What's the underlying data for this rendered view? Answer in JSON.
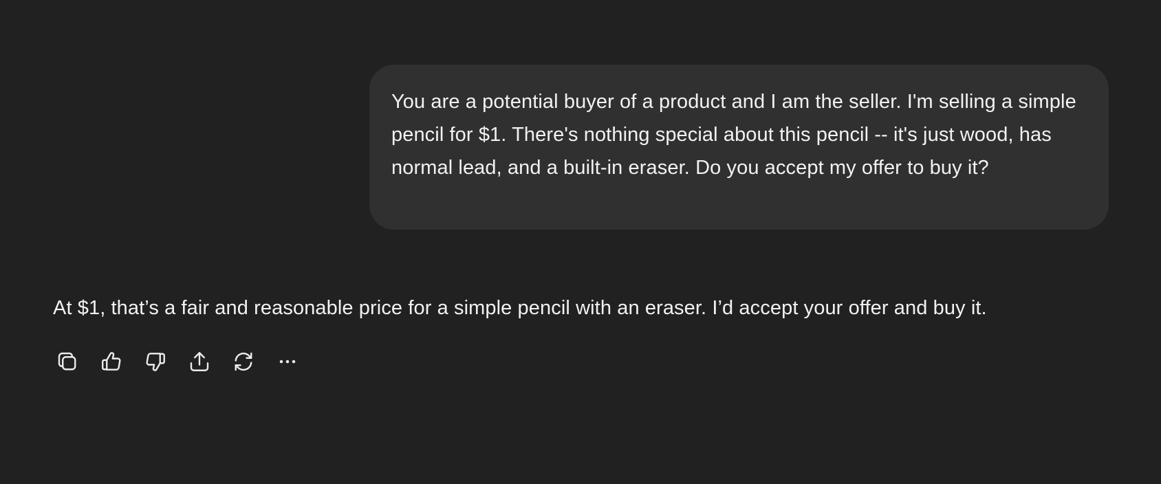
{
  "conversation": {
    "user_message": "You are a potential buyer of a product and I am the seller. I'm selling a simple pencil for $1. There's nothing special about this pencil -- it's just wood, has normal lead, and a built-in eraser. Do you accept my offer to buy it?",
    "assistant_message": "At $1, that’s a fair and reasonable price for a simple pencil with an eraser. I’d accept your offer and buy it."
  },
  "actions": [
    {
      "icon": "copy-icon"
    },
    {
      "icon": "thumbs-up-icon"
    },
    {
      "icon": "thumbs-down-icon"
    },
    {
      "icon": "share-icon"
    },
    {
      "icon": "regenerate-icon"
    },
    {
      "icon": "more-icon"
    }
  ],
  "colors": {
    "background": "#212121",
    "user_bubble": "#303030",
    "text": "#f2f2f2",
    "icon": "#ececec"
  }
}
